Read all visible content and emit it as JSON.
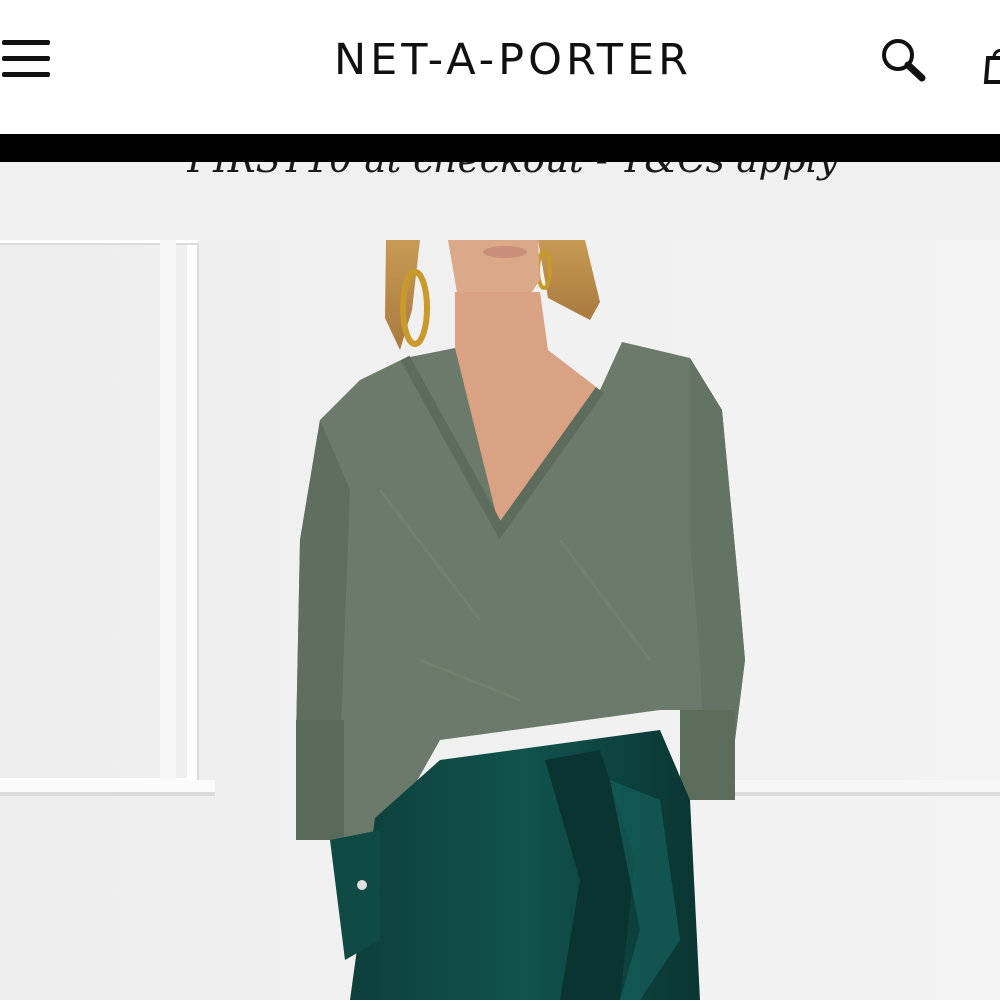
{
  "header": {
    "brand": "NET-A-PORTER",
    "icons": [
      "menu-icon",
      "search-icon",
      "shopping-bag-icon"
    ]
  },
  "promo_banner": {
    "text": "FIRST10 at checkout - T&Cs apply"
  },
  "colors": {
    "header_bg": "#ffffff",
    "bar": "#000000",
    "hero_bg": "#f0f0f0",
    "sweater": "#6b7a6a",
    "skirt": "#0f4a45"
  }
}
